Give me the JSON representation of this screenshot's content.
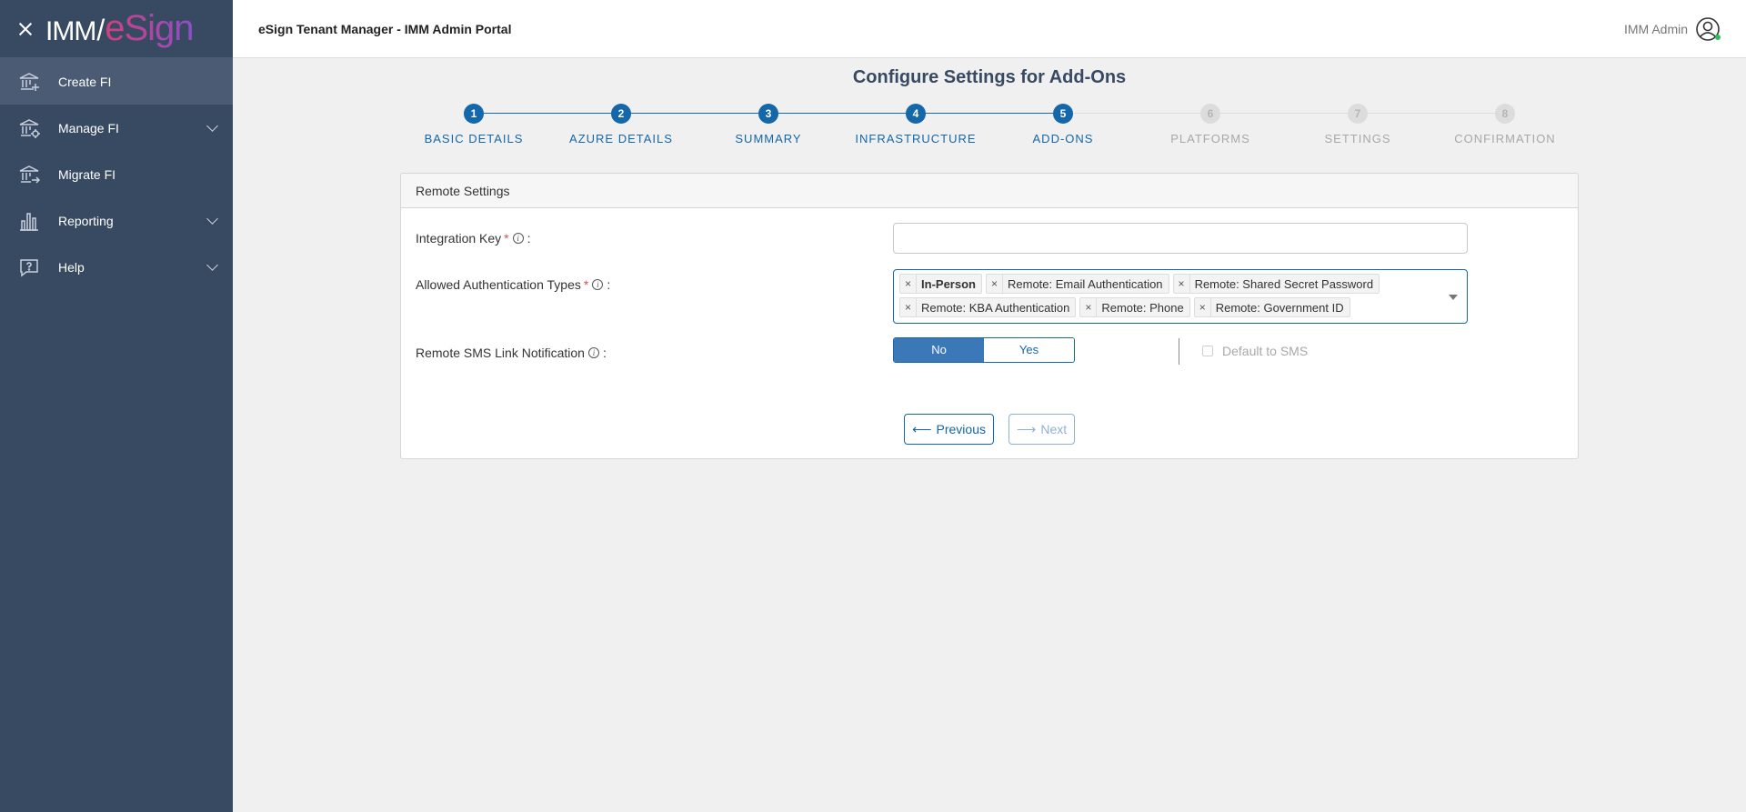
{
  "sidebar": {
    "logo": {
      "imm": "IMM",
      "slash": "/",
      "esign": "eSign"
    },
    "items": [
      {
        "label": "Create FI",
        "icon": "bank-plus-icon",
        "active": true
      },
      {
        "label": "Manage FI",
        "icon": "bank-gear-icon",
        "expandable": true
      },
      {
        "label": "Migrate FI",
        "icon": "bank-arrow-icon"
      },
      {
        "label": "Reporting",
        "icon": "bar-chart-icon",
        "expandable": true
      },
      {
        "label": "Help",
        "icon": "help-bubble-icon",
        "expandable": true
      }
    ]
  },
  "header": {
    "title": "eSign Tenant Manager - IMM Admin Portal",
    "user_name": "IMM Admin"
  },
  "page": {
    "title": "Configure Settings for Add-Ons"
  },
  "stepper": {
    "active_color": "#1467a9",
    "steps": [
      {
        "num": "1",
        "label": "BASIC DETAILS",
        "status": "done"
      },
      {
        "num": "2",
        "label": "AZURE DETAILS",
        "status": "done"
      },
      {
        "num": "3",
        "label": "SUMMARY",
        "status": "done"
      },
      {
        "num": "4",
        "label": "INFRASTRUCTURE",
        "status": "done"
      },
      {
        "num": "5",
        "label": "ADD-ONS",
        "status": "current"
      },
      {
        "num": "6",
        "label": "PLATFORMS",
        "status": "pending"
      },
      {
        "num": "7",
        "label": "SETTINGS",
        "status": "pending"
      },
      {
        "num": "8",
        "label": "CONFIRMATION",
        "status": "pending"
      }
    ]
  },
  "panel": {
    "title": "Remote Settings",
    "integration_key": {
      "label": "Integration Key",
      "required_mark": "*",
      "info": "i",
      "colon": ":",
      "value": ""
    },
    "auth_types": {
      "label": "Allowed Authentication Types",
      "required_mark": "*",
      "info": "i",
      "colon": ":",
      "selected": [
        {
          "label": "In-Person",
          "bold": true
        },
        {
          "label": "Remote: Email Authentication",
          "bold": false
        },
        {
          "label": "Remote: Shared Secret Password",
          "bold": false
        },
        {
          "label": "Remote: KBA Authentication",
          "bold": false
        },
        {
          "label": "Remote: Phone",
          "bold": false
        },
        {
          "label": "Remote: Government ID",
          "bold": false
        }
      ],
      "remove_glyph": "×"
    },
    "sms_notification": {
      "label": "Remote SMS Link Notification",
      "info": "i",
      "colon": ":",
      "no_label": "No",
      "yes_label": "Yes",
      "selected": "No",
      "default_sms_label": "Default to SMS",
      "default_sms_checked": false
    },
    "buttons": {
      "previous_label": "Previous",
      "previous_arrow": "⟵",
      "next_label": "Next",
      "next_arrow": "⟶"
    }
  }
}
